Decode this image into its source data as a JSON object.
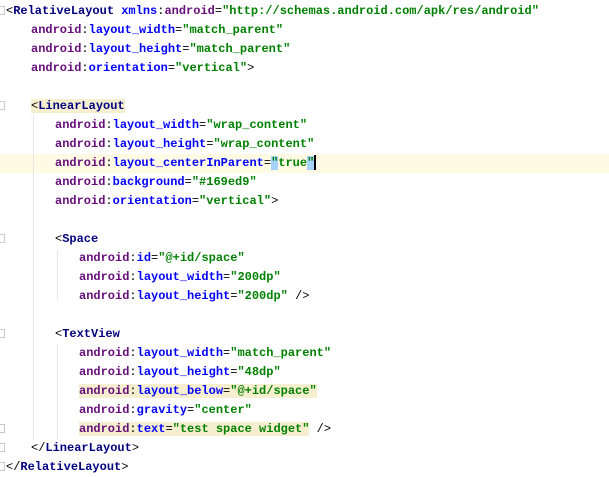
{
  "editor": {
    "current_line": 8,
    "lines": [
      {
        "indent": 0,
        "tokens": [
          [
            "p",
            "<"
          ],
          [
            "t",
            "RelativeLayout"
          ],
          [
            "p",
            " "
          ],
          [
            "a",
            "xmlns"
          ],
          [
            "p",
            ":"
          ],
          [
            "ns",
            "android"
          ],
          [
            "p",
            "="
          ],
          [
            "v",
            "\"http://schemas.android.com/apk/res/android\""
          ]
        ]
      },
      {
        "indent": 1,
        "tokens": [
          [
            "ns",
            "android"
          ],
          [
            "p",
            ":"
          ],
          [
            "a",
            "layout_width"
          ],
          [
            "p",
            "="
          ],
          [
            "v",
            "\"match_parent\""
          ]
        ]
      },
      {
        "indent": 1,
        "tokens": [
          [
            "ns",
            "android"
          ],
          [
            "p",
            ":"
          ],
          [
            "a",
            "layout_height"
          ],
          [
            "p",
            "="
          ],
          [
            "v",
            "\"match_parent\""
          ]
        ]
      },
      {
        "indent": 1,
        "tokens": [
          [
            "ns",
            "android"
          ],
          [
            "p",
            ":"
          ],
          [
            "a",
            "orientation"
          ],
          [
            "p",
            "="
          ],
          [
            "v",
            "\"vertical\""
          ],
          [
            "p",
            ">"
          ]
        ]
      },
      {
        "indent": 0,
        "tokens": []
      },
      {
        "indent": 1,
        "tokens": [
          [
            "p",
            "<"
          ],
          [
            "t",
            "LinearLayout"
          ]
        ],
        "highlight": true
      },
      {
        "indent": 2,
        "tokens": [
          [
            "ns",
            "android"
          ],
          [
            "p",
            ":"
          ],
          [
            "a",
            "layout_width"
          ],
          [
            "p",
            "="
          ],
          [
            "v",
            "\"wrap_content\""
          ]
        ]
      },
      {
        "indent": 2,
        "tokens": [
          [
            "ns",
            "android"
          ],
          [
            "p",
            ":"
          ],
          [
            "a",
            "layout_height"
          ],
          [
            "p",
            "="
          ],
          [
            "v",
            "\"wrap_content\""
          ]
        ]
      },
      {
        "indent": 2,
        "tokens": [
          [
            "ns",
            "android"
          ],
          [
            "p",
            ":"
          ],
          [
            "a",
            "layout_centerInParent"
          ],
          [
            "p",
            "="
          ],
          [
            "vs",
            "\""
          ],
          [
            "v",
            "true"
          ],
          [
            "vs",
            "\""
          ]
        ]
      },
      {
        "indent": 2,
        "tokens": [
          [
            "ns",
            "android"
          ],
          [
            "p",
            ":"
          ],
          [
            "a",
            "background"
          ],
          [
            "p",
            "="
          ],
          [
            "v",
            "\"#169ed9\""
          ]
        ]
      },
      {
        "indent": 2,
        "tokens": [
          [
            "ns",
            "android"
          ],
          [
            "p",
            ":"
          ],
          [
            "a",
            "orientation"
          ],
          [
            "p",
            "="
          ],
          [
            "v",
            "\"vertical\""
          ],
          [
            "p",
            ">"
          ]
        ]
      },
      {
        "indent": 0,
        "tokens": []
      },
      {
        "indent": 2,
        "tokens": [
          [
            "p",
            "<"
          ],
          [
            "t",
            "Space"
          ]
        ]
      },
      {
        "indent": 3,
        "tokens": [
          [
            "ns",
            "android"
          ],
          [
            "p",
            ":"
          ],
          [
            "a",
            "id"
          ],
          [
            "p",
            "="
          ],
          [
            "v",
            "\"@+id/space\""
          ]
        ]
      },
      {
        "indent": 3,
        "tokens": [
          [
            "ns",
            "android"
          ],
          [
            "p",
            ":"
          ],
          [
            "a",
            "layout_width"
          ],
          [
            "p",
            "="
          ],
          [
            "v",
            "\"200dp\""
          ]
        ]
      },
      {
        "indent": 3,
        "tokens": [
          [
            "ns",
            "android"
          ],
          [
            "p",
            ":"
          ],
          [
            "a",
            "layout_height"
          ],
          [
            "p",
            "="
          ],
          [
            "v",
            "\"200dp\""
          ],
          [
            "p",
            " />"
          ]
        ]
      },
      {
        "indent": 0,
        "tokens": []
      },
      {
        "indent": 2,
        "tokens": [
          [
            "p",
            "<"
          ],
          [
            "t",
            "TextView"
          ]
        ]
      },
      {
        "indent": 3,
        "tokens": [
          [
            "ns",
            "android"
          ],
          [
            "p",
            ":"
          ],
          [
            "a",
            "layout_width"
          ],
          [
            "p",
            "="
          ],
          [
            "v",
            "\"match_parent\""
          ]
        ]
      },
      {
        "indent": 3,
        "tokens": [
          [
            "ns",
            "android"
          ],
          [
            "p",
            ":"
          ],
          [
            "a",
            "layout_height"
          ],
          [
            "p",
            "="
          ],
          [
            "v",
            "\"48dp\""
          ]
        ]
      },
      {
        "indent": 3,
        "tokens": [
          [
            "ns",
            "android"
          ],
          [
            "p",
            ":"
          ],
          [
            "a",
            "layout_below"
          ],
          [
            "p",
            "="
          ],
          [
            "v",
            "\"@+id/space\""
          ]
        ],
        "highlight": true
      },
      {
        "indent": 3,
        "tokens": [
          [
            "ns",
            "android"
          ],
          [
            "p",
            ":"
          ],
          [
            "a",
            "gravity"
          ],
          [
            "p",
            "="
          ],
          [
            "v",
            "\"center\""
          ]
        ]
      },
      {
        "indent": 3,
        "tokens": [
          [
            "ns",
            "android"
          ],
          [
            "p",
            ":"
          ],
          [
            "a",
            "text"
          ],
          [
            "p",
            "="
          ],
          [
            "v",
            "\"test space widget\""
          ]
        ],
        "highlight": true,
        "tail": " />"
      },
      {
        "indent": 1,
        "tokens": [
          [
            "p",
            "</"
          ],
          [
            "t",
            "LinearLayout"
          ],
          [
            "p",
            ">"
          ]
        ]
      },
      {
        "indent": 0,
        "tokens": [
          [
            "p",
            "</"
          ],
          [
            "t",
            "RelativeLayout"
          ],
          [
            "p",
            ">"
          ]
        ]
      }
    ]
  }
}
